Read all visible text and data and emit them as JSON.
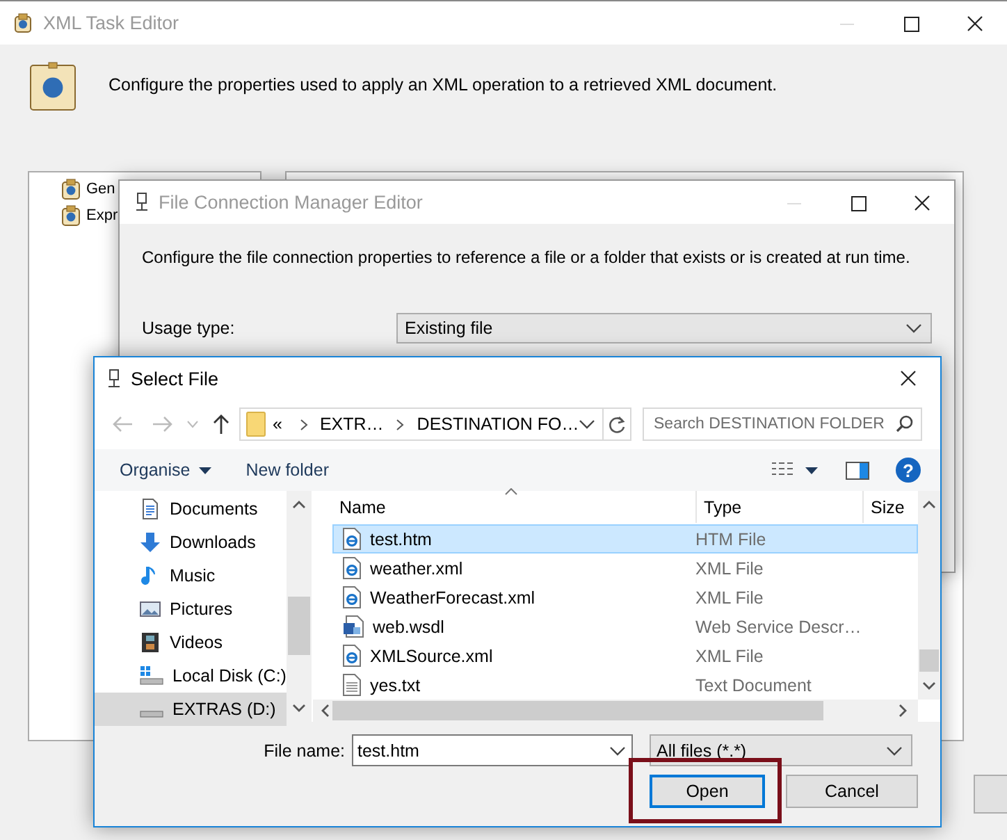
{
  "xml_task_editor": {
    "title": "XML Task Editor",
    "active": false,
    "description": "Configure the properties used to apply an XML operation to a retrieved XML document.",
    "pages": [
      {
        "label": "Gen"
      },
      {
        "label": "Expr"
      }
    ]
  },
  "file_connection_manager_editor": {
    "title": "File Connection Manager Editor",
    "active": false,
    "description": "Configure the file connection properties to reference a file or a folder that exists or is created at run time.",
    "usage_type": {
      "label": "Usage type:",
      "value": "Existing file"
    }
  },
  "select_file": {
    "title": "Select File",
    "active": true,
    "address": {
      "overflow": "«",
      "breadcrumbs": [
        "EXTR…",
        "DESTINATION FO…"
      ]
    },
    "search": {
      "placeholder": "Search DESTINATION FOLDER"
    },
    "toolbar": {
      "organise": "Organise",
      "new_folder": "New folder",
      "help": "?"
    },
    "nav_items": [
      {
        "label": "Documents",
        "kind": "documents",
        "selected": false
      },
      {
        "label": "Downloads",
        "kind": "downloads",
        "selected": false
      },
      {
        "label": "Music",
        "kind": "music",
        "selected": false
      },
      {
        "label": "Pictures",
        "kind": "pictures",
        "selected": false
      },
      {
        "label": "Videos",
        "kind": "videos",
        "selected": false
      },
      {
        "label": "Local Disk (C:)",
        "kind": "system-drive",
        "selected": false
      },
      {
        "label": "EXTRAS (D:)",
        "kind": "drive",
        "selected": true
      }
    ],
    "columns": [
      "Name",
      "Type",
      "Size"
    ],
    "files": [
      {
        "name": "test.htm",
        "type": "HTM File",
        "kind": "web",
        "selected": true
      },
      {
        "name": "weather.xml",
        "type": "XML File",
        "kind": "web",
        "selected": false
      },
      {
        "name": "WeatherForecast.xml",
        "type": "XML File",
        "kind": "web",
        "selected": false
      },
      {
        "name": "web.wsdl",
        "type": "Web Service Descr…",
        "kind": "wsdl",
        "selected": false
      },
      {
        "name": "XMLSource.xml",
        "type": "XML File",
        "kind": "web",
        "selected": false
      },
      {
        "name": "yes.txt",
        "type": "Text Document",
        "kind": "text",
        "selected": false
      }
    ],
    "file_name": {
      "label": "File name:",
      "value": "test.htm"
    },
    "file_type": {
      "value": "All files (*.*)"
    },
    "buttons": [
      {
        "label": "Open",
        "default": true,
        "highlighted": true
      },
      {
        "label": "Cancel",
        "default": false,
        "highlighted": false
      }
    ]
  }
}
